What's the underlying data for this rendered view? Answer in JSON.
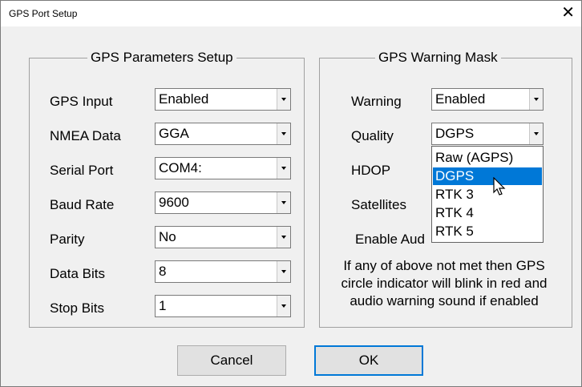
{
  "window": {
    "title": "GPS Port Setup",
    "close_glyph": "✕"
  },
  "params": {
    "legend": "GPS Parameters Setup",
    "rows": [
      {
        "label": "GPS Input",
        "value": "Enabled"
      },
      {
        "label": "NMEA Data",
        "value": "GGA"
      },
      {
        "label": "Serial Port",
        "value": "COM4:"
      },
      {
        "label": "Baud Rate",
        "value": "9600"
      },
      {
        "label": "Parity",
        "value": "No"
      },
      {
        "label": "Data Bits",
        "value": "8"
      },
      {
        "label": "Stop Bits",
        "value": "1"
      }
    ]
  },
  "warning": {
    "legend": "GPS Warning Mask",
    "warning_label": "Warning",
    "warning_value": "Enabled",
    "quality_label": "Quality",
    "quality_value": "DGPS",
    "hdop_label": "HDOP",
    "satellites_label": "Satellites",
    "enable_audio_label_visible": "Enable Aud",
    "quality_options": [
      "Raw (AGPS)",
      "DGPS",
      "RTK 3",
      "RTK 4",
      "RTK 5"
    ],
    "selected_option_index": 1,
    "note_lines": [
      "If any of above not met then GPS",
      "circle indicator will blink in red and",
      "audio warning sound if enabled"
    ]
  },
  "buttons": {
    "cancel": "Cancel",
    "ok": "OK"
  },
  "icons": {
    "close": "close-icon",
    "dropdown": "chevron-down-icon",
    "cursor": "pointer-cursor-icon"
  },
  "colors": {
    "selection": "#0078d7",
    "default_button_border": "#0078d7"
  }
}
